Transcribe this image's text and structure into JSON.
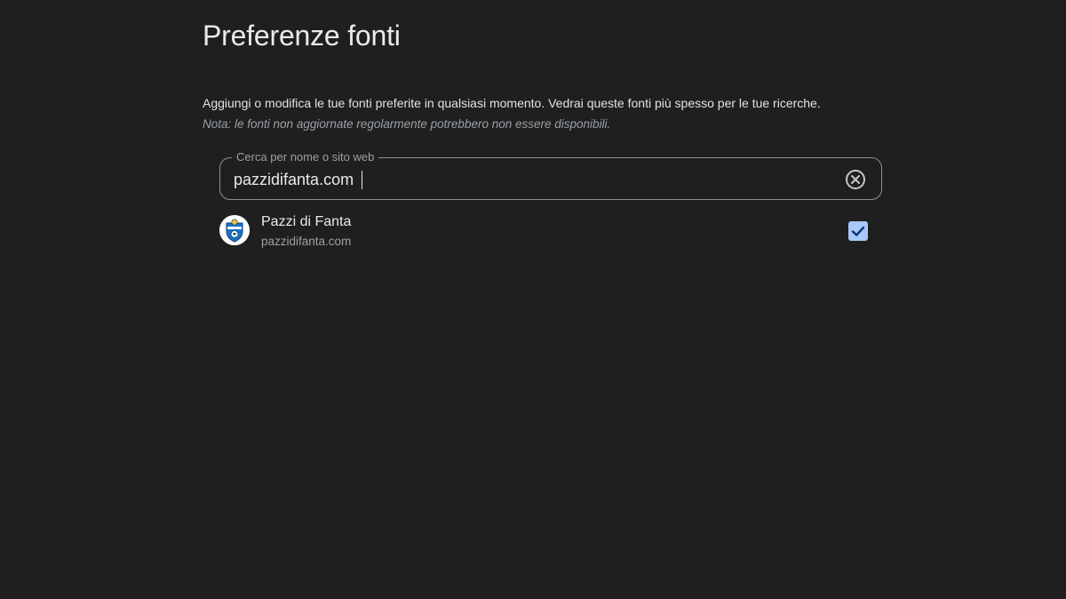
{
  "page": {
    "title": "Preferenze fonti",
    "description": "Aggiungi o modifica le tue fonti preferite in qualsiasi momento. Vedrai queste fonti più spesso per le tue ricerche.",
    "note": "Nota: le fonti non aggiornate regolarmente potrebbero non essere disponibili."
  },
  "search": {
    "label": "Cerca per nome o sito web",
    "value": "pazzidifanta.com",
    "clear_icon": "cancel-circle-icon"
  },
  "results": [
    {
      "name": "Pazzi di Fanta",
      "domain": "pazzidifanta.com",
      "favicon_icon": "pazzi-di-fanta-logo",
      "checked": true,
      "check_icon": "checkmark-icon"
    }
  ],
  "colors": {
    "background": "#1f1f1f",
    "text_primary": "#e8eaed",
    "text_secondary": "#9aa0a6",
    "field_border": "#8e918f",
    "accent": "#a8c7fa"
  }
}
